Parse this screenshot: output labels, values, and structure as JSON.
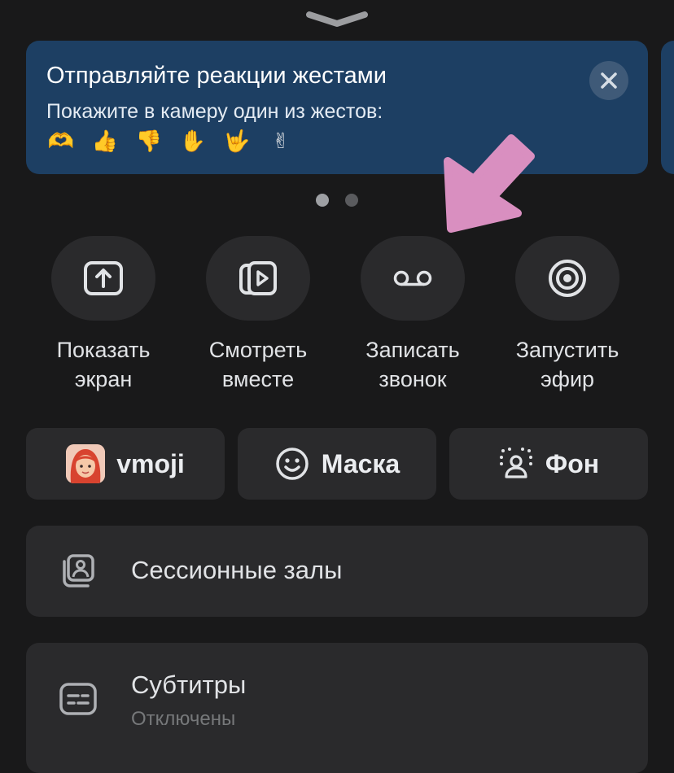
{
  "banner": {
    "title": "Отправляйте реакции жестами",
    "subtitle": "Покажите в камеру один из жестов:",
    "gestures": [
      "🫶",
      "👍",
      "👎",
      "✋",
      "🤟",
      "✌"
    ]
  },
  "pagination": {
    "count": 2,
    "active": 1
  },
  "actions": [
    {
      "label": "Показать\nэкран",
      "icon": "screen-share-icon"
    },
    {
      "label": "Смотреть\nвместе",
      "icon": "watch-together-icon"
    },
    {
      "label": "Записать\nзвонок",
      "icon": "record-icon"
    },
    {
      "label": "Запустить\nэфир",
      "icon": "broadcast-icon"
    }
  ],
  "pills": {
    "vmoji": "vmoji",
    "mask": "Маска",
    "background": "Фон"
  },
  "rows": {
    "sessions": {
      "title": "Сессионные залы"
    },
    "subtitles": {
      "title": "Субтитры",
      "status": "Отключены"
    }
  },
  "colors": {
    "background": "#19191a",
    "surface": "#2a2a2c",
    "banner": "#1d3f63",
    "arrow": "#d98fc0"
  }
}
